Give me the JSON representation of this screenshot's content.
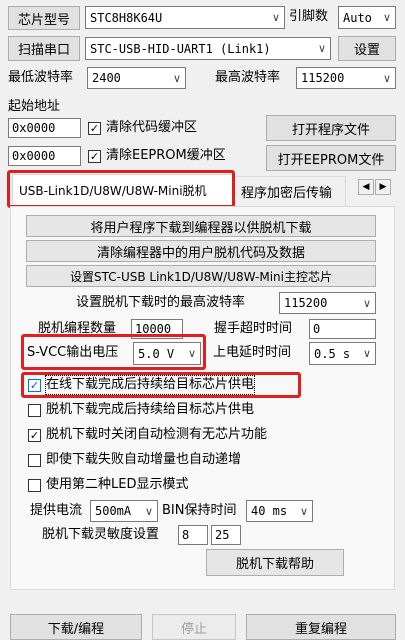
{
  "chip": {
    "label": "芯片型号",
    "value": "STC8H8K64U"
  },
  "pins": {
    "label": "引脚数",
    "value": "Auto"
  },
  "port": {
    "scan_button": "扫描串口",
    "value": "STC-USB-HID-UART1 (Link1)",
    "settings_button": "设置"
  },
  "baud": {
    "min_label": "最低波特率",
    "min_value": "2400",
    "max_label": "最高波特率",
    "max_value": "115200"
  },
  "start": {
    "label": "起始地址",
    "code_addr": "0x0000",
    "clear_code_label": "清除代码缓冲区",
    "open_program_button": "打开程序文件",
    "eeprom_addr": "0x0000",
    "clear_eeprom_label": "清除EEPROM缓冲区",
    "open_eeprom_button": "打开EEPROM文件"
  },
  "tabs": {
    "active": "USB-Link1D/U8W/U8W-Mini脱机",
    "next": "程序加密后传输"
  },
  "offline": {
    "download_button": "将用户程序下载到编程器以供脱机下载",
    "clear_button": "清除编程器中的用户脱机代码及数据",
    "setup_button": "设置STC-USB Link1D/U8W/U8W-Mini主控芯片",
    "max_baud_label": "设置脱机下载时的最高波特率",
    "max_baud_value": "115200",
    "count_label": "脱机编程数量",
    "count_value": "10000",
    "handshake_label": "握手超时时间",
    "handshake_value": "0",
    "vcc_label": "S-VCC输出电压",
    "vcc_value": "5.0 V",
    "power_delay_label": "上电延时时间",
    "power_delay_value": "0.5 s",
    "checks": [
      {
        "label": "在线下载完成后持续给目标芯片供电",
        "checked": true
      },
      {
        "label": "脱机下载完成后持续给目标芯片供电",
        "checked": false
      },
      {
        "label": "脱机下载时关闭自动检测有无芯片功能",
        "checked": true
      },
      {
        "label": "即使下载失败自动增量也自动递增",
        "checked": false
      },
      {
        "label": "使用第二种LED显示模式",
        "checked": false
      }
    ],
    "current_label": "提供电流",
    "current_value": "500mA",
    "bin_label": "BIN保持时间",
    "bin_value": "40 ms",
    "sensitivity_label": "脱机下载灵敏度设置",
    "sensitivity_a": "8",
    "sensitivity_b": "25",
    "help_button": "脱机下载帮助"
  },
  "bottom": {
    "download_button": "下载/编程",
    "stop_button": "停止",
    "repeat_button": "重复编程"
  },
  "colors": {
    "highlight": "#e02020",
    "focus": "#0078d7"
  }
}
